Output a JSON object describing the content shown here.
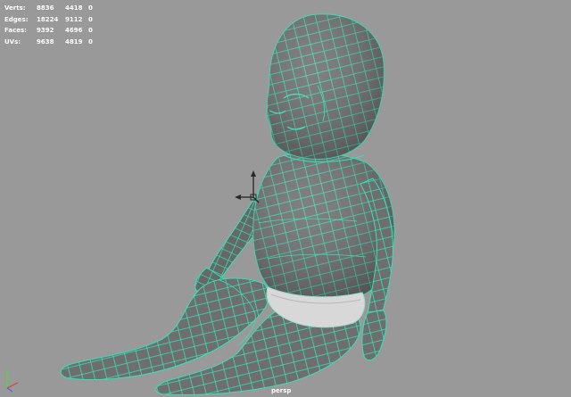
{
  "hud": {
    "rows": [
      {
        "label": "Verts:",
        "total": "8836",
        "selected": "4418",
        "extra": "0"
      },
      {
        "label": "Edges:",
        "total": "18224",
        "selected": "9112",
        "extra": "0"
      },
      {
        "label": "Faces:",
        "total": "9392",
        "selected": "4696",
        "extra": "0"
      },
      {
        "label": "UVs:",
        "total": "9638",
        "selected": "4819",
        "extra": "0"
      }
    ]
  },
  "camera": {
    "name": "persp"
  },
  "colors": {
    "viewport_bg": "#999999",
    "mesh_fill": "#6e6e6e",
    "wire": "#39e0b4",
    "diaper": "#d8d8d8"
  },
  "icons": [
    "move-manipulator-icon",
    "view-axis-icon"
  ]
}
